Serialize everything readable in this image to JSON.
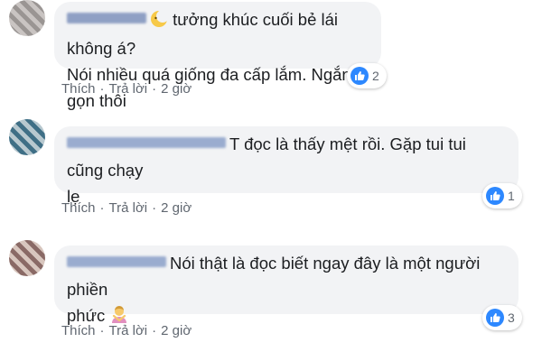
{
  "comments": [
    {
      "text_lines": [
        "tưởng khúc cuối bẻ lái không á?",
        "Nói nhiều quá giống đa cấp lắm. Ngắn gọn thôi"
      ],
      "reaction_count": "2",
      "actions": {
        "like": "Thích",
        "reply": "Trả lời",
        "time": "2 giờ"
      }
    },
    {
      "text_lines": [
        "T đọc là thấy mệt rồi. Gặp tui tui cũng chạy",
        "lẹ"
      ],
      "reaction_count": "1",
      "actions": {
        "like": "Thích",
        "reply": "Trả lời",
        "time": "2 giờ"
      }
    },
    {
      "text_lines": [
        "Nói thật là đọc biết ngay đây là một người phiền",
        "phức"
      ],
      "reaction_count": "3",
      "actions": {
        "like": "Thích",
        "reply": "Trả lời",
        "time": "2 giờ"
      }
    }
  ],
  "separator": "·",
  "icons": [
    "moon-emoji-icon",
    "person-gesturing-no-emoji-icon",
    "like-icon"
  ]
}
